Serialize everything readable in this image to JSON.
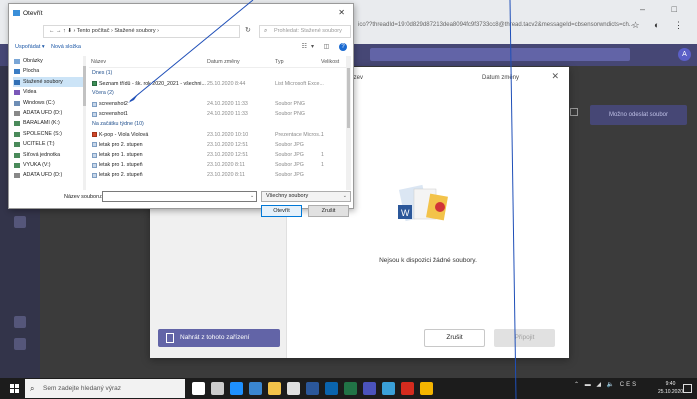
{
  "browser": {
    "url_fragment": "ico??threadId=19:0d829d87213dea8094fc9f3733cc8@thread.tacv2&messageId=cbsensorwndicts=ch..."
  },
  "teams": {
    "join_button": "Možno odeslat soubor",
    "avatar": "A"
  },
  "modal": {
    "col_name": "Název",
    "col_date": "Datum změny",
    "empty_text": "Nejsou k dispozici žádné soubory.",
    "upload_button": "Nahrát z tohoto zařízení",
    "cancel_button": "Zrušit",
    "attach_button": "Připojit"
  },
  "dialog": {
    "title": "Otevřít",
    "breadcrumb": "← → ↑ ⬇  ›  Tento počítač  ›  Stažené soubory  ›",
    "search_placeholder": "Prohledat: Stažené soubory",
    "toolbar": {
      "organize": "Uspořádat ▾",
      "new_folder": "Nová složka"
    },
    "nav_items": [
      {
        "label": "Obrázky",
        "color": "#7aa6d6"
      },
      {
        "label": "Plocha",
        "color": "#3b7dc4"
      },
      {
        "label": "Stažené soubory",
        "color": "#2f6fb5",
        "selected": true
      },
      {
        "label": "Videa",
        "color": "#7a57b8"
      },
      {
        "label": "Windows (C:)",
        "color": "#6d8db5"
      },
      {
        "label": "ADATA UFD (D:)",
        "color": "#888888"
      },
      {
        "label": "BARALAMI (K:)",
        "color": "#4a8a5a"
      },
      {
        "label": "SPOLECNE (S:)",
        "color": "#4a8a5a"
      },
      {
        "label": "UCITELE (T:)",
        "color": "#4a8a5a"
      },
      {
        "label": "Síťová jednotka",
        "color": "#4a8a5a"
      },
      {
        "label": "VYUKA (V:)",
        "color": "#4a8a5a"
      },
      {
        "label": "ADATA UFD (D:)",
        "color": "#888888"
      }
    ],
    "columns": {
      "name": "Název",
      "date": "Datum změny",
      "type": "Typ",
      "size": "Velikost"
    },
    "groups": [
      {
        "label": "Dnes (1)",
        "files": [
          {
            "name": "Seznam třídů - šk. rok 2020_2021 - všechni...",
            "date": "25.10.2020 8:44",
            "type": "List Microsoft Exce...",
            "size": "",
            "kind": "xls"
          }
        ]
      },
      {
        "label": "Včera (2)",
        "files": [
          {
            "name": "screenshot2",
            "date": "24.10.2020 11:33",
            "type": "Soubor PNG",
            "size": "",
            "kind": "img"
          },
          {
            "name": "screenshot1",
            "date": "24.10.2020 11:33",
            "type": "Soubor PNG",
            "size": "",
            "kind": "img"
          }
        ]
      },
      {
        "label": "Na začátku týdne (10)",
        "files": [
          {
            "name": "K-pop - Viola Violová",
            "date": "23.10.2020 10:10",
            "type": "Prezentace Micros...",
            "size": "1",
            "kind": "ppt"
          },
          {
            "name": "letak pro 2. stupen",
            "date": "23.10.2020 12:51",
            "type": "Soubor JPG",
            "size": "",
            "kind": "img"
          },
          {
            "name": "letak pro 1. stupen",
            "date": "23.10.2020 12:51",
            "type": "Soubor JPG",
            "size": "1",
            "kind": "img"
          },
          {
            "name": "letak pro 1. stupeň",
            "date": "23.10.2020 8:11",
            "type": "Soubor JPG",
            "size": "1",
            "kind": "img"
          },
          {
            "name": "letak pro 2. stupeň",
            "date": "23.10.2020 8:11",
            "type": "Soubor JPG",
            "size": "",
            "kind": "img"
          }
        ]
      }
    ],
    "filename_label": "Název souboru:",
    "filename_value": "",
    "filetype_value": "Všechny soubory",
    "open_button": "Otevřít",
    "cancel_button": "Zrušit"
  },
  "taskbar": {
    "search_placeholder": "Sem zadejte hledaný výraz",
    "tray": "⌃ ▬ ◢ 🔈 CES",
    "time": "9:40",
    "date": "25.10.2020",
    "apps": [
      {
        "name": "cortana",
        "color": "#ffffff"
      },
      {
        "name": "task-view",
        "color": "#cccccc"
      },
      {
        "name": "edge",
        "color": "#1e90ff"
      },
      {
        "name": "store",
        "color": "#3a86d0"
      },
      {
        "name": "files",
        "color": "#f3c34a"
      },
      {
        "name": "lock",
        "color": "#e0e0e0"
      },
      {
        "name": "word",
        "color": "#2b579a"
      },
      {
        "name": "outlook",
        "color": "#0a64ad"
      },
      {
        "name": "excel",
        "color": "#217346"
      },
      {
        "name": "teams",
        "color": "#4b53bc"
      },
      {
        "name": "network",
        "color": "#3aa0d8"
      },
      {
        "name": "acrobat",
        "color": "#d42b1e"
      },
      {
        "name": "chrome",
        "color": "#f4b400"
      }
    ]
  }
}
